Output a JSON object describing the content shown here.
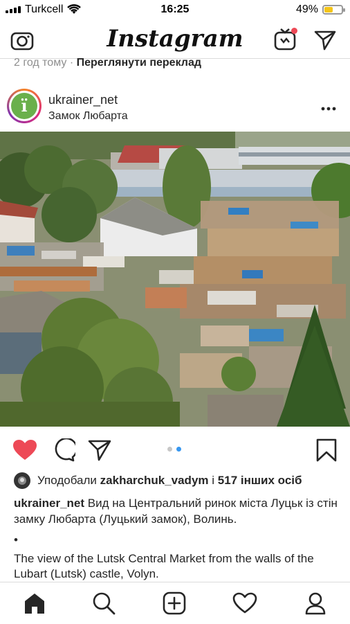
{
  "status": {
    "carrier": "Turkcell",
    "time": "16:25",
    "battery_percent": "49%",
    "battery_level": 0.49
  },
  "nav": {
    "logo": "Instagram"
  },
  "post": {
    "time_ago": "2 год тому",
    "see_translation": "Переглянути переклад",
    "username": "ukrainer_net",
    "location": "Замок Любарта",
    "avatar_letter": "ї",
    "likes_prefix": "Уподобали",
    "liker": "zakharchuk_vadym",
    "likes_joiner": "і",
    "others": "517 інших осіб",
    "caption_user": "ukrainer_net",
    "caption_text": "Вид на Центральний ринок міста Луцьк із стін замку Любарта (Луцький замок), Волинь.",
    "caption_bullet": "•",
    "caption_en": "The view of the Lutsk Central Market from the walls of the Lubart (Lutsk) castle, Volyn.",
    "carousel_index": 2,
    "carousel_total": 2
  },
  "colors": {
    "like_red": "#ed4956",
    "pager_active": "#3897f0",
    "battery_yellow": "#f5c518"
  }
}
